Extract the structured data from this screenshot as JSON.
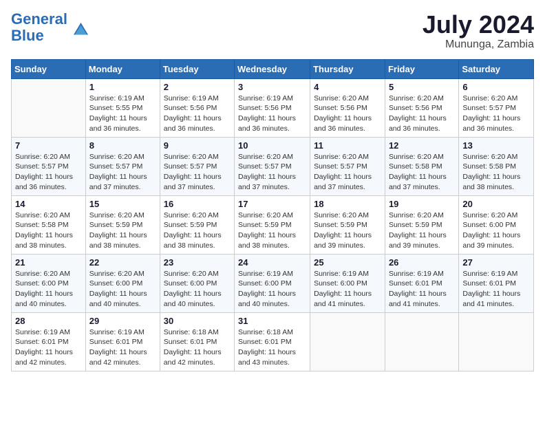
{
  "logo": {
    "line1": "General",
    "line2": "Blue"
  },
  "title": "July 2024",
  "location": "Mununga, Zambia",
  "days_of_week": [
    "Sunday",
    "Monday",
    "Tuesday",
    "Wednesday",
    "Thursday",
    "Friday",
    "Saturday"
  ],
  "weeks": [
    [
      {
        "day": "",
        "info": ""
      },
      {
        "day": "1",
        "info": "Sunrise: 6:19 AM\nSunset: 5:55 PM\nDaylight: 11 hours and 36 minutes."
      },
      {
        "day": "2",
        "info": "Sunrise: 6:19 AM\nSunset: 5:56 PM\nDaylight: 11 hours and 36 minutes."
      },
      {
        "day": "3",
        "info": "Sunrise: 6:19 AM\nSunset: 5:56 PM\nDaylight: 11 hours and 36 minutes."
      },
      {
        "day": "4",
        "info": "Sunrise: 6:20 AM\nSunset: 5:56 PM\nDaylight: 11 hours and 36 minutes."
      },
      {
        "day": "5",
        "info": "Sunrise: 6:20 AM\nSunset: 5:56 PM\nDaylight: 11 hours and 36 minutes."
      },
      {
        "day": "6",
        "info": "Sunrise: 6:20 AM\nSunset: 5:57 PM\nDaylight: 11 hours and 36 minutes."
      }
    ],
    [
      {
        "day": "7",
        "info": "Sunrise: 6:20 AM\nSunset: 5:57 PM\nDaylight: 11 hours and 36 minutes."
      },
      {
        "day": "8",
        "info": "Sunrise: 6:20 AM\nSunset: 5:57 PM\nDaylight: 11 hours and 37 minutes."
      },
      {
        "day": "9",
        "info": "Sunrise: 6:20 AM\nSunset: 5:57 PM\nDaylight: 11 hours and 37 minutes."
      },
      {
        "day": "10",
        "info": "Sunrise: 6:20 AM\nSunset: 5:57 PM\nDaylight: 11 hours and 37 minutes."
      },
      {
        "day": "11",
        "info": "Sunrise: 6:20 AM\nSunset: 5:57 PM\nDaylight: 11 hours and 37 minutes."
      },
      {
        "day": "12",
        "info": "Sunrise: 6:20 AM\nSunset: 5:58 PM\nDaylight: 11 hours and 37 minutes."
      },
      {
        "day": "13",
        "info": "Sunrise: 6:20 AM\nSunset: 5:58 PM\nDaylight: 11 hours and 38 minutes."
      }
    ],
    [
      {
        "day": "14",
        "info": "Sunrise: 6:20 AM\nSunset: 5:58 PM\nDaylight: 11 hours and 38 minutes."
      },
      {
        "day": "15",
        "info": "Sunrise: 6:20 AM\nSunset: 5:59 PM\nDaylight: 11 hours and 38 minutes."
      },
      {
        "day": "16",
        "info": "Sunrise: 6:20 AM\nSunset: 5:59 PM\nDaylight: 11 hours and 38 minutes."
      },
      {
        "day": "17",
        "info": "Sunrise: 6:20 AM\nSunset: 5:59 PM\nDaylight: 11 hours and 38 minutes."
      },
      {
        "day": "18",
        "info": "Sunrise: 6:20 AM\nSunset: 5:59 PM\nDaylight: 11 hours and 39 minutes."
      },
      {
        "day": "19",
        "info": "Sunrise: 6:20 AM\nSunset: 5:59 PM\nDaylight: 11 hours and 39 minutes."
      },
      {
        "day": "20",
        "info": "Sunrise: 6:20 AM\nSunset: 6:00 PM\nDaylight: 11 hours and 39 minutes."
      }
    ],
    [
      {
        "day": "21",
        "info": "Sunrise: 6:20 AM\nSunset: 6:00 PM\nDaylight: 11 hours and 40 minutes."
      },
      {
        "day": "22",
        "info": "Sunrise: 6:20 AM\nSunset: 6:00 PM\nDaylight: 11 hours and 40 minutes."
      },
      {
        "day": "23",
        "info": "Sunrise: 6:20 AM\nSunset: 6:00 PM\nDaylight: 11 hours and 40 minutes."
      },
      {
        "day": "24",
        "info": "Sunrise: 6:19 AM\nSunset: 6:00 PM\nDaylight: 11 hours and 40 minutes."
      },
      {
        "day": "25",
        "info": "Sunrise: 6:19 AM\nSunset: 6:00 PM\nDaylight: 11 hours and 41 minutes."
      },
      {
        "day": "26",
        "info": "Sunrise: 6:19 AM\nSunset: 6:01 PM\nDaylight: 11 hours and 41 minutes."
      },
      {
        "day": "27",
        "info": "Sunrise: 6:19 AM\nSunset: 6:01 PM\nDaylight: 11 hours and 41 minutes."
      }
    ],
    [
      {
        "day": "28",
        "info": "Sunrise: 6:19 AM\nSunset: 6:01 PM\nDaylight: 11 hours and 42 minutes."
      },
      {
        "day": "29",
        "info": "Sunrise: 6:19 AM\nSunset: 6:01 PM\nDaylight: 11 hours and 42 minutes."
      },
      {
        "day": "30",
        "info": "Sunrise: 6:18 AM\nSunset: 6:01 PM\nDaylight: 11 hours and 42 minutes."
      },
      {
        "day": "31",
        "info": "Sunrise: 6:18 AM\nSunset: 6:01 PM\nDaylight: 11 hours and 43 minutes."
      },
      {
        "day": "",
        "info": ""
      },
      {
        "day": "",
        "info": ""
      },
      {
        "day": "",
        "info": ""
      }
    ]
  ]
}
